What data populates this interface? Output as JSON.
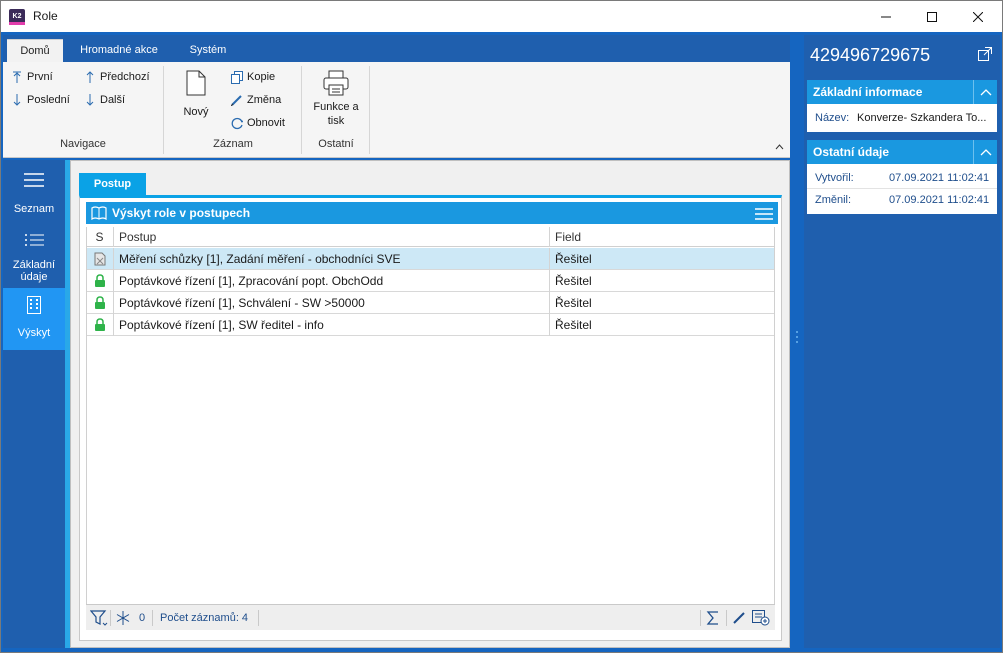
{
  "window": {
    "title": "Role"
  },
  "ribbon": {
    "tabs": [
      "Domů",
      "Hromadné akce",
      "Systém"
    ],
    "navigace": {
      "first": "První",
      "previous": "Předchozí",
      "last": "Poslední",
      "next": "Další",
      "group": "Navigace"
    },
    "zaznam": {
      "new": "Nový",
      "copy": "Kopie",
      "change": "Změna",
      "refresh": "Obnovit",
      "group": "Záznam"
    },
    "ostatni": {
      "functions": "Funkce a tisk",
      "group": "Ostatní"
    }
  },
  "leftnav": {
    "items": [
      {
        "label": "Seznam",
        "icon": "list-lines-icon"
      },
      {
        "label": "Základní údaje",
        "icon": "bullet-list-icon"
      },
      {
        "label": "Výskyt",
        "icon": "building-icon"
      }
    ]
  },
  "content": {
    "tab": "Postup",
    "grid": {
      "title": "Výskyt role v postupech",
      "columns": [
        "S",
        "Postup",
        "Field"
      ],
      "rows": [
        {
          "status_icon": "document-icon",
          "postup": "Měření schůzky [1], Zadání měření - obchodníci SVE",
          "field": "Řešitel"
        },
        {
          "status_icon": "lock-icon",
          "postup": "Poptávkové řízení [1], Zpracování popt. ObchOdd",
          "field": "Řešitel"
        },
        {
          "status_icon": "lock-icon",
          "postup": "Poptávkové řízení [1], Schválení - SW >50000",
          "field": "Řešitel"
        },
        {
          "status_icon": "lock-icon",
          "postup": "Poptávkové řízení [1], SW ředitel - info",
          "field": "Řešitel"
        }
      ]
    },
    "status": {
      "selected_count": "0",
      "record_count": "Počet záznamů: 4"
    }
  },
  "right_panel": {
    "id": "429496729675",
    "basic": {
      "title": "Základní informace",
      "name_label": "Název:",
      "name_value": "Konverze- Szkandera To..."
    },
    "other": {
      "title": "Ostatní údaje",
      "created_label": "Vytvořil:",
      "created_value": "07.09.2021 11:02:41",
      "changed_label": "Změnil:",
      "changed_value": "07.09.2021 11:02:41"
    }
  },
  "colors": {
    "accent": "#1a98e0",
    "frame": "#1565c0",
    "lock": "#2fb34a",
    "selected_row": "#cde8f6"
  }
}
